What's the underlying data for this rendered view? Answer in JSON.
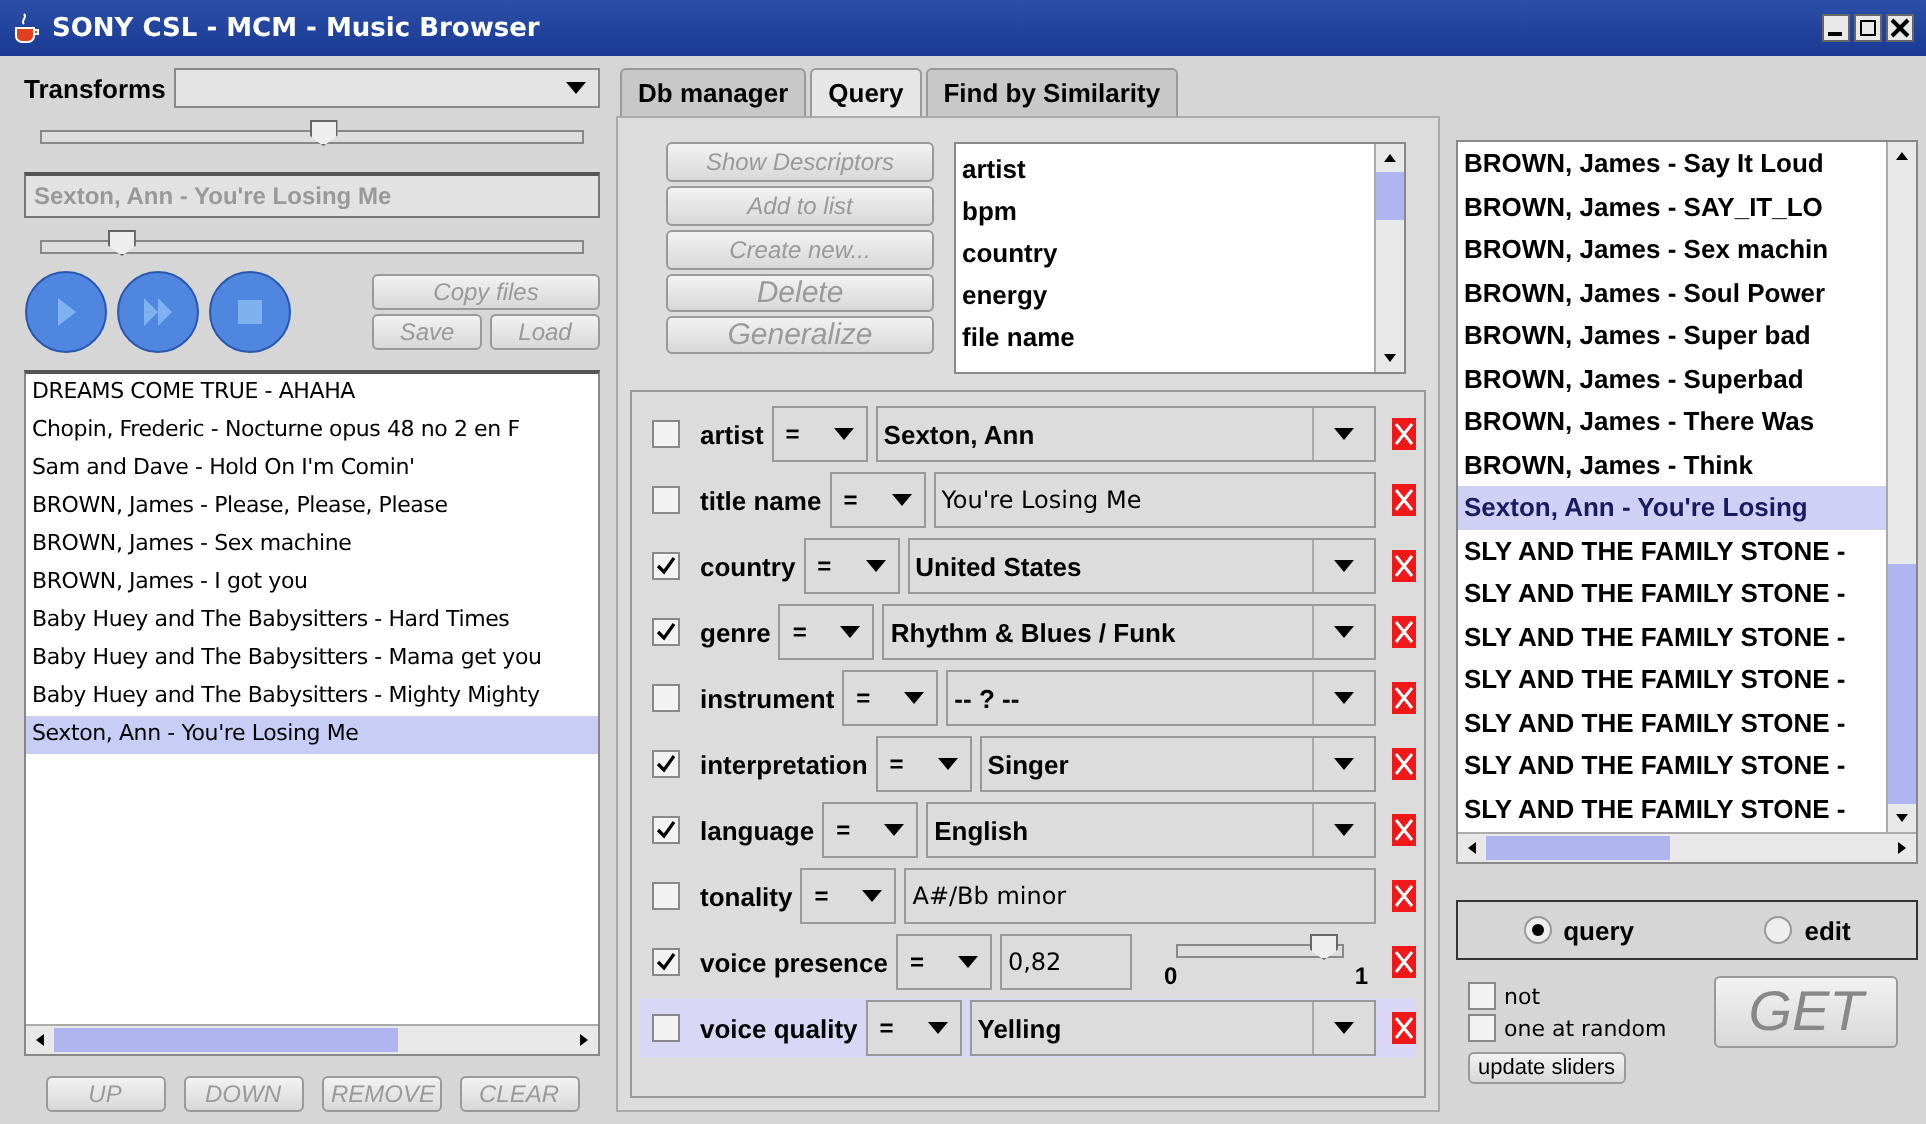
{
  "window": {
    "title": "SONY CSL - MCM - Music Browser"
  },
  "left_panel": {
    "transforms": {
      "label": "Transforms",
      "level": 0.52
    },
    "current_track": {
      "value": "Sexton, Ann - You're Losing Me",
      "disabled": true,
      "level": 0.17
    },
    "file_buttons": [
      "Copy files",
      "Save",
      "Load"
    ],
    "playlist": [
      {
        "title": "DREAMS COME TRUE - AHAHA",
        "selected": false
      },
      {
        "title": "Chopin, Frederic - Nocturne opus 48 no 2 en F",
        "selected": false
      },
      {
        "title": "Sam and Dave - Hold On I'm Comin'",
        "selected": false
      },
      {
        "title": "BROWN, James - Please, Please, Please",
        "selected": false
      },
      {
        "title": "BROWN, James - Sex machine",
        "selected": false
      },
      {
        "title": "BROWN, James - I got you",
        "selected": false
      },
      {
        "title": "Baby Huey and  The Babysitters - Hard Times",
        "selected": false
      },
      {
        "title": "Baby Huey and  The Babysitters - Mama get you",
        "selected": false
      },
      {
        "title": "Baby Huey and  The Babysitters - Mighty Mighty",
        "selected": false
      },
      {
        "title": "Sexton, Ann - You're Losing Me",
        "selected": true
      }
    ],
    "list_buttons": [
      "UP",
      "DOWN",
      "REMOVE",
      "CLEAR"
    ]
  },
  "tabs": [
    {
      "label": "Db manager",
      "selected": false
    },
    {
      "label": "Query",
      "selected": true
    },
    {
      "label": "Find by Similarity",
      "selected": false
    }
  ],
  "query_panel": {
    "actions": [
      "Show Descriptors",
      "Add to list",
      "Create new...",
      "Delete",
      "Generalize"
    ],
    "descriptors": [
      "artist",
      "bpm",
      "country",
      "energy",
      "file name"
    ],
    "criteria": [
      {
        "kind": "combo",
        "checked": false,
        "name": "artist",
        "operator": "=",
        "value": "Sexton, Ann",
        "selected": false
      },
      {
        "kind": "text",
        "checked": false,
        "name": "title name",
        "operator": "=",
        "value": "You're Losing Me",
        "selected": false
      },
      {
        "kind": "combo",
        "checked": true,
        "name": "country",
        "operator": "=",
        "value": "United States",
        "selected": false
      },
      {
        "kind": "combo",
        "checked": true,
        "name": "genre",
        "operator": "=",
        "value": "Rhythm & Blues / Funk",
        "selected": false
      },
      {
        "kind": "combo",
        "checked": false,
        "name": "instrument",
        "operator": "=",
        "value": "-- ? --",
        "selected": false
      },
      {
        "kind": "combo",
        "checked": true,
        "name": "interpretation",
        "operator": "=",
        "value": "Singer",
        "selected": false
      },
      {
        "kind": "combo",
        "checked": true,
        "name": "language",
        "operator": "=",
        "value": "English",
        "selected": false
      },
      {
        "kind": "text",
        "checked": false,
        "name": "tonality",
        "operator": "=",
        "value": "A#/Bb minor",
        "selected": false
      },
      {
        "kind": "slider",
        "checked": true,
        "name": "voice presence",
        "operator": "=",
        "value": "0,82",
        "min": "0",
        "max": "1",
        "level": 0.82,
        "selected": false
      },
      {
        "kind": "combo",
        "checked": false,
        "name": "voice quality",
        "operator": "=",
        "value": "Yelling",
        "selected": true
      }
    ]
  },
  "results": {
    "items": [
      {
        "title": "BROWN, James - Say It Loud",
        "selected": false
      },
      {
        "title": "BROWN, James - SAY_IT_LO",
        "selected": false
      },
      {
        "title": "BROWN, James - Sex machin",
        "selected": false
      },
      {
        "title": "BROWN, James - Soul Power",
        "selected": false
      },
      {
        "title": "BROWN, James - Super bad",
        "selected": false
      },
      {
        "title": "BROWN, James - Superbad",
        "selected": false
      },
      {
        "title": "BROWN, James - There Was",
        "selected": false
      },
      {
        "title": "BROWN, James - Think",
        "selected": false
      },
      {
        "title": "Sexton, Ann - You're Losing",
        "selected": true
      },
      {
        "title": "SLY AND THE FAMILY STONE -",
        "selected": false
      },
      {
        "title": "SLY AND THE FAMILY STONE -",
        "selected": false
      },
      {
        "title": "SLY AND THE FAMILY STONE -",
        "selected": false
      },
      {
        "title": "SLY AND THE FAMILY STONE -",
        "selected": false
      },
      {
        "title": "SLY AND THE FAMILY STONE -",
        "selected": false
      },
      {
        "title": "SLY AND THE FAMILY STONE -",
        "selected": false
      },
      {
        "title": "SLY AND THE FAMILY STONE -",
        "selected": false
      }
    ],
    "mode": [
      {
        "label": "query",
        "selected": true
      },
      {
        "label": "edit",
        "selected": false
      }
    ],
    "options": [
      {
        "label": "not",
        "checked": false
      },
      {
        "label": "one at random",
        "checked": false
      }
    ],
    "get_button": "GET",
    "update_button": "update sliders"
  }
}
